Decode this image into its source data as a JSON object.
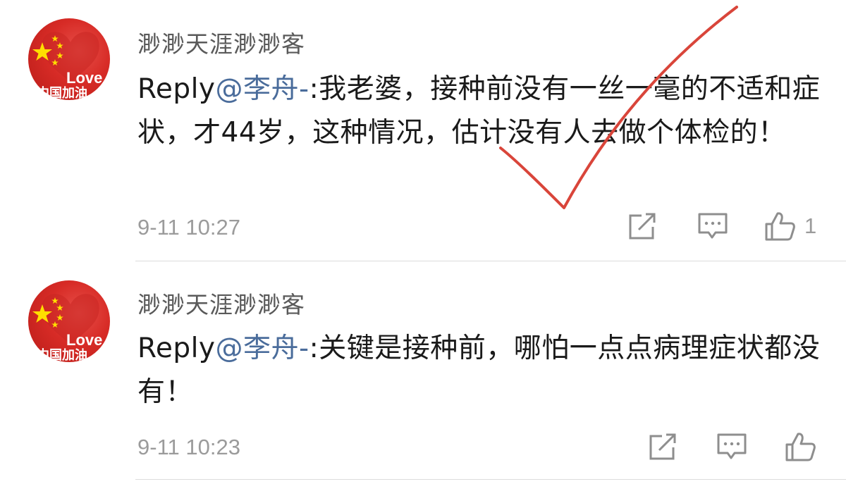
{
  "comments": [
    {
      "username": "渺渺天涯渺渺客",
      "reply_prefix": "Reply",
      "mention": "@李舟-",
      "text": ":我老婆，接种前没有一丝一毫的不适和症状，才44岁，这种情况，估计没有人去做个体检的！",
      "timestamp": "9-11 10:27",
      "like_count": "1",
      "avatar_text": "Love中国加油"
    },
    {
      "username": "渺渺天涯渺渺客",
      "reply_prefix": "Reply",
      "mention": "@李舟-",
      "text": ":关键是接种前，哪怕一点点病理症状都没有！",
      "timestamp": "9-11 10:23",
      "like_count": "",
      "avatar_text": "Love中国加油"
    }
  ],
  "icons": {
    "share": "share-icon",
    "reply": "comment-icon",
    "like": "thumbs-up-icon"
  },
  "colors": {
    "mention": "#4a6c9b",
    "meta": "#9b9b9b",
    "annotation": "#d9453a",
    "avatar_red": "#d72b26",
    "star_yellow": "#ffde00"
  }
}
